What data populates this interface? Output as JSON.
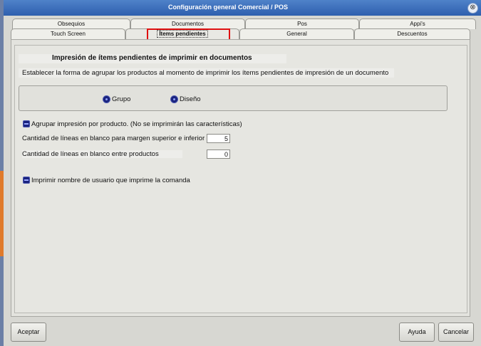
{
  "window": {
    "title": "Configuración general Comercial / POS",
    "close_label": "⊗"
  },
  "tabs_back": [
    {
      "label": "Obsequios"
    },
    {
      "label": "Documentos"
    },
    {
      "label": "Pos"
    },
    {
      "label": "Appi's"
    }
  ],
  "tabs_front": [
    {
      "label": "Touch Screen"
    },
    {
      "label": "Ítems pendientes"
    },
    {
      "label": "General"
    },
    {
      "label": "Descuentos"
    }
  ],
  "active_tab": "Ítems pendientes",
  "section": {
    "heading": "Impresión de ítems pendientes de imprimir en documentos",
    "description": "Establecer la forma de agrupar los productos al momento de imprimir los ítems pendientes de impresión de un documento"
  },
  "grouping_options": [
    {
      "label": "Grupo"
    },
    {
      "label": "Diseño"
    }
  ],
  "options": {
    "group_by_product": "Agrupar impresión por producto. (No se imprimirán las características)",
    "blank_lines_margin_label": "Cantidad de líneas en blanco para margen superior e inferior",
    "blank_lines_margin_value": "5",
    "blank_lines_products_label": "Cantidad de líneas en blanco entre productos",
    "blank_lines_products_value": "0",
    "print_username": "Imprimir nombre de usuario que imprime la comanda"
  },
  "footer": {
    "accept": "Aceptar",
    "help": "Ayuda",
    "cancel": "Cancelar"
  },
  "colors": {
    "highlight": "#e01010",
    "titlebar": "#3a6bb8"
  }
}
